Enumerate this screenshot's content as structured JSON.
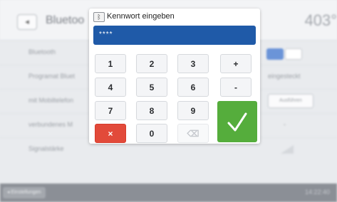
{
  "header": {
    "back_icon": "back-icon",
    "title": "Bluetoo",
    "temperature": "403°"
  },
  "settings": {
    "rows": [
      {
        "label": "Bluetooth"
      },
      {
        "label": "Programat Bluet",
        "value": "eingesteckt"
      },
      {
        "label": "mit Mobiltelefon",
        "button": "Ausführen"
      },
      {
        "label": "verbundenes M",
        "value": "-"
      },
      {
        "label": "Signalstärke"
      }
    ]
  },
  "footer": {
    "back_label": "◂ Einstellungen",
    "time": "14:22:40"
  },
  "dialog": {
    "title": "Kennwort eingeben",
    "password_value": "****",
    "keys": {
      "k1": "1",
      "k2": "2",
      "k3": "3",
      "plus": "+",
      "k4": "4",
      "k5": "5",
      "k6": "6",
      "minus": "-",
      "k7": "7",
      "k8": "8",
      "k9": "9",
      "cancel": "×",
      "k0": "0",
      "backspace": "⌫"
    }
  },
  "colors": {
    "accent": "#1f5aa8",
    "ok_green": "#55ad3c",
    "cancel_red": "#e24a3a"
  }
}
